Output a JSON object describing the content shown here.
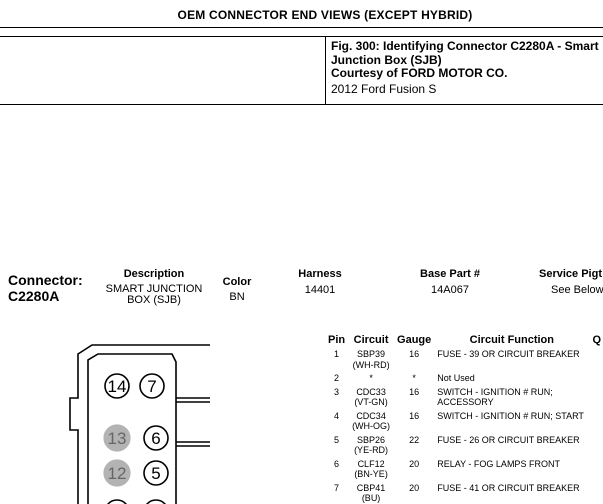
{
  "document": {
    "title": "OEM CONNECTOR END VIEWS (EXCEPT HYBRID)",
    "caption": {
      "figure": "Fig. 300: Identifying Connector C2280A - Smart Junction Box (SJB)",
      "courtesy": "Courtesy of FORD MOTOR CO.",
      "vehicle": "2012 Ford Fusion S"
    }
  },
  "connector": {
    "label_line1": "Connector:",
    "label_line2": "C2280A",
    "headers": {
      "description": "Description",
      "color": "Color",
      "harness": "Harness",
      "base_part": "Base Part #",
      "service_pigtail": "Service Pigt"
    },
    "values": {
      "description_line1": "SMART JUNCTION",
      "description_line2": "BOX (SJB)",
      "color": "BN",
      "harness": "14401",
      "base_part": "14A067",
      "service_pigtail": "See Below"
    }
  },
  "pin_table": {
    "headers": [
      "Pin",
      "Circuit",
      "Gauge",
      "Circuit Function",
      "Q"
    ],
    "rows": [
      {
        "pin": "1",
        "circuit": "SBP39",
        "color": "(WH-RD)",
        "gauge": "16",
        "function": "FUSE - 39 OR CIRCUIT BREAKER",
        "function2": ""
      },
      {
        "pin": "2",
        "circuit": "*",
        "color": "",
        "gauge": "*",
        "function": "Not Used",
        "function2": ""
      },
      {
        "pin": "3",
        "circuit": "CDC33",
        "color": "(VT-GN)",
        "gauge": "16",
        "function": "SWITCH - IGNITION # RUN;",
        "function2": "ACCESSORY"
      },
      {
        "pin": "4",
        "circuit": "CDC34",
        "color": "(WH-OG)",
        "gauge": "16",
        "function": "SWITCH - IGNITION # RUN; START",
        "function2": ""
      },
      {
        "pin": "5",
        "circuit": "SBP26",
        "color": "(YE-RD)",
        "gauge": "22",
        "function": "FUSE - 26 OR CIRCUIT BREAKER",
        "function2": ""
      },
      {
        "pin": "6",
        "circuit": "CLF12",
        "color": "(BN-YE)",
        "gauge": "20",
        "function": "RELAY - FOG LAMPS FRONT",
        "function2": ""
      },
      {
        "pin": "7",
        "circuit": "CBP41",
        "color": "(BU)",
        "gauge": "20",
        "function": "FUSE - 41 OR CIRCUIT BREAKER",
        "function2": ""
      }
    ]
  },
  "diagram": {
    "pin_labels": [
      "14",
      "7",
      "13",
      "6",
      "12",
      "5"
    ],
    "shaded_pins": [
      "13",
      "12"
    ],
    "colors": {
      "shaded_fill": "#b3b3b3",
      "stroke": "#000000"
    }
  }
}
